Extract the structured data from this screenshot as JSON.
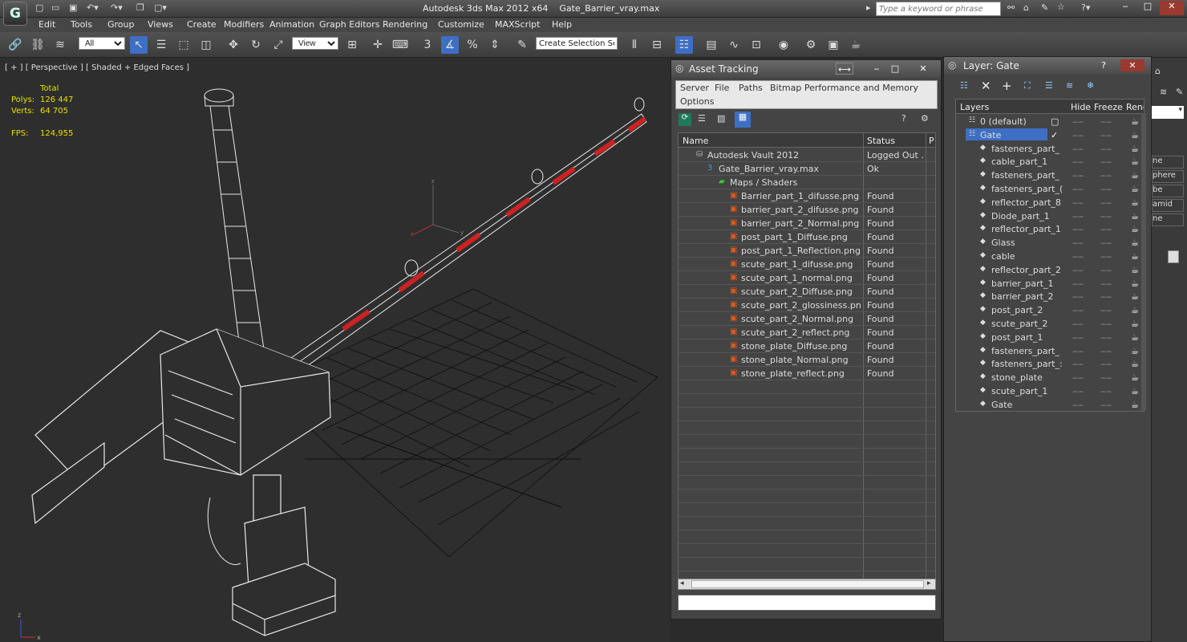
{
  "titlebar": {
    "app_title": "Autodesk 3ds Max  2012 x64",
    "file_name": "Gate_Barrier_vray.max",
    "search_placeholder": "Type a keyword or phrase"
  },
  "menu": [
    "Edit",
    "Tools",
    "Group",
    "Views",
    "Create",
    "Modifiers",
    "Animation",
    "Graph Editors",
    "Rendering",
    "Customize",
    "MAXScript",
    "Help"
  ],
  "toolbar": {
    "filter_value": "All",
    "ref_coord_value": "View",
    "selection_set_placeholder": "Create Selection Se",
    "snap_label": "3",
    "percent_label": "%"
  },
  "viewport": {
    "label": "[ + ] [ Perspective ] [ Shaded + Edged Faces ]",
    "stats_header": "Total",
    "polys_label": "Polys:",
    "polys_value": "126 447",
    "verts_label": "Verts:",
    "verts_value": "64 705",
    "fps_label": "FPS:",
    "fps_value": "124,955",
    "axis_z": "z",
    "axis_y": "y",
    "axis_x": "x"
  },
  "asset_tracking": {
    "title": "Asset Tracking",
    "menu": [
      "Server",
      "File",
      "Paths",
      "Bitmap Performance and Memory"
    ],
    "menu2": "Options",
    "col_name": "Name",
    "col_status": "Status",
    "col_p": "P",
    "rows": [
      {
        "name": "Autodesk Vault 2012",
        "status": "Logged Out ...",
        "indent": 1,
        "icon": "vault-icon"
      },
      {
        "name": "Gate_Barrier_vray.max",
        "status": "Ok",
        "indent": 2,
        "icon": "max-file-icon"
      },
      {
        "name": "Maps / Shaders",
        "status": "",
        "indent": 3,
        "icon": "maps-icon"
      },
      {
        "name": "Barrier_part_1_difusse.png",
        "status": "Found",
        "indent": 4,
        "icon": "image-icon"
      },
      {
        "name": "barrier_part_2_difusse.png",
        "status": "Found",
        "indent": 4,
        "icon": "image-icon"
      },
      {
        "name": "barrier_part_2_Normal.png",
        "status": "Found",
        "indent": 4,
        "icon": "image-icon"
      },
      {
        "name": "post_part_1_Diffuse.png",
        "status": "Found",
        "indent": 4,
        "icon": "image-icon"
      },
      {
        "name": "post_part_1_Reflection.png",
        "status": "Found",
        "indent": 4,
        "icon": "image-icon"
      },
      {
        "name": "scute_part_1_difusse.png",
        "status": "Found",
        "indent": 4,
        "icon": "image-icon"
      },
      {
        "name": "scute_part_1_normal.png",
        "status": "Found",
        "indent": 4,
        "icon": "image-icon"
      },
      {
        "name": "scute_part_2_Diffuse.png",
        "status": "Found",
        "indent": 4,
        "icon": "image-icon"
      },
      {
        "name": "scute_part_2_glossiness.png",
        "status": "Found",
        "indent": 4,
        "icon": "image-icon"
      },
      {
        "name": "scute_part_2_Normal.png",
        "status": "Found",
        "indent": 4,
        "icon": "image-icon"
      },
      {
        "name": "scute_part_2_reflect.png",
        "status": "Found",
        "indent": 4,
        "icon": "image-icon"
      },
      {
        "name": "stone_plate_Diffuse.png",
        "status": "Found",
        "indent": 4,
        "icon": "image-icon"
      },
      {
        "name": "stone_plate_Normal.png",
        "status": "Found",
        "indent": 4,
        "icon": "image-icon"
      },
      {
        "name": "stone_plate_reflect.png",
        "status": "Found",
        "indent": 4,
        "icon": "image-icon"
      }
    ]
  },
  "layer_panel": {
    "title": "Layer: Gate",
    "col_layers": "Layers",
    "col_hide": "Hide",
    "col_freeze": "Freeze",
    "col_render": "Rende",
    "items": [
      {
        "name": "0 (default)",
        "type": "layer"
      },
      {
        "name": "Gate",
        "type": "layer-selected"
      },
      {
        "name": "fasteners_part_",
        "type": "object"
      },
      {
        "name": "cable_part_1",
        "type": "object"
      },
      {
        "name": "fasteners_part_",
        "type": "object"
      },
      {
        "name": "fasteners_part_(",
        "type": "object"
      },
      {
        "name": "reflector_part_8",
        "type": "object"
      },
      {
        "name": "Diode_part_1",
        "type": "object"
      },
      {
        "name": "reflector_part_1",
        "type": "object"
      },
      {
        "name": "Glass",
        "type": "object"
      },
      {
        "name": "cable",
        "type": "object"
      },
      {
        "name": "reflector_part_2",
        "type": "object"
      },
      {
        "name": "barrier_part_1",
        "type": "object"
      },
      {
        "name": "barrier_part_2",
        "type": "object"
      },
      {
        "name": "post_part_2",
        "type": "object"
      },
      {
        "name": "scute_part_2",
        "type": "object"
      },
      {
        "name": "post_part_1",
        "type": "object"
      },
      {
        "name": "fasteners_part_",
        "type": "object"
      },
      {
        "name": "fasteners_part_:",
        "type": "object"
      },
      {
        "name": "stone_plate",
        "type": "object"
      },
      {
        "name": "scute_part_1",
        "type": "object"
      },
      {
        "name": "Gate",
        "type": "object"
      }
    ]
  },
  "right_strip": {
    "items": [
      "ne",
      "phere",
      "be",
      "amid",
      "ne"
    ]
  },
  "colors": {
    "selection_blue": "#3d6fc4",
    "barrier_red": "#cc2222",
    "viewport_bg": "#2e2e2e"
  }
}
